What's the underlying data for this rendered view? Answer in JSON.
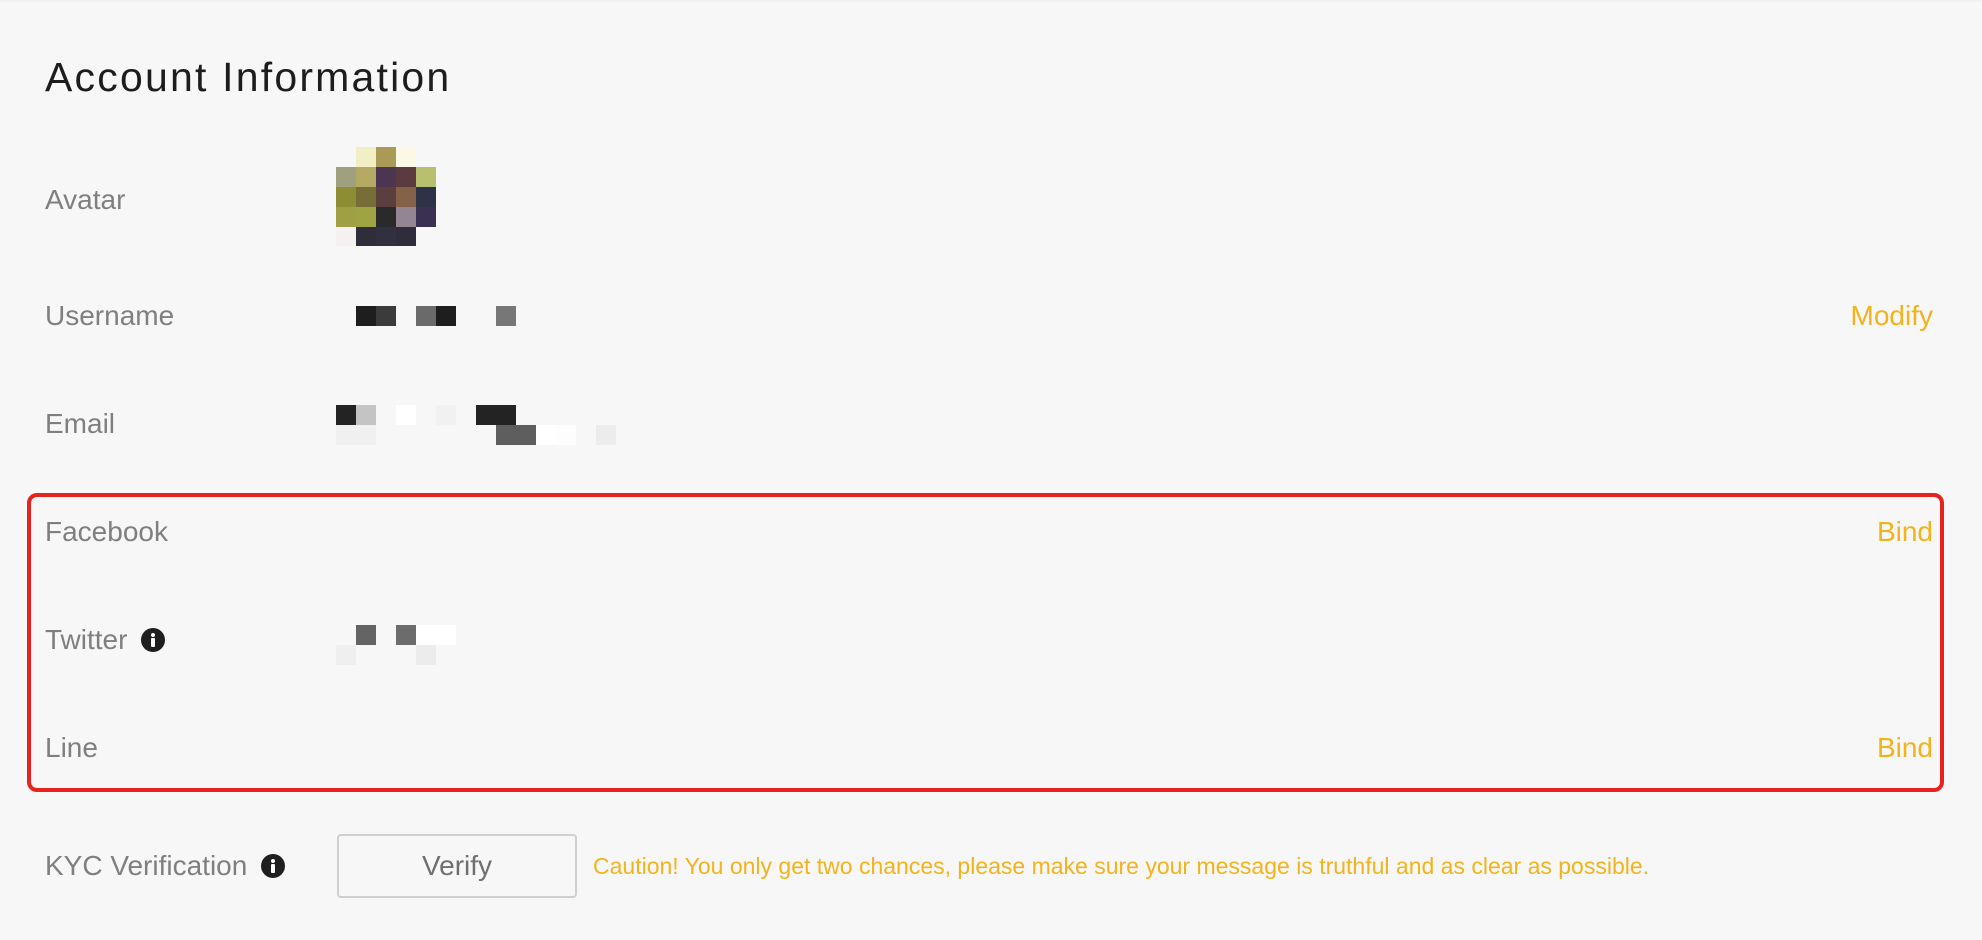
{
  "page": {
    "title": "Account Information"
  },
  "rows": {
    "avatar": {
      "label": "Avatar"
    },
    "username": {
      "label": "Username",
      "action": "Modify"
    },
    "email": {
      "label": "Email"
    },
    "facebook": {
      "label": "Facebook",
      "action": "Bind"
    },
    "twitter": {
      "label": "Twitter"
    },
    "line": {
      "label": "Line",
      "action": "Bind"
    },
    "kyc": {
      "label": "KYC Verification",
      "button": "Verify",
      "caution": "Caution! You only get two chances, please make sure your message is truthful and as clear as possible."
    }
  },
  "icons": {
    "twitter_info": "info-icon",
    "kyc_info": "info-icon"
  },
  "colors": {
    "accent": "#f3b31c",
    "highlight_border": "#e5231f",
    "background": "#f7f7f7",
    "label_text": "#7f7f7f",
    "title_text": "#1d1d1f"
  }
}
